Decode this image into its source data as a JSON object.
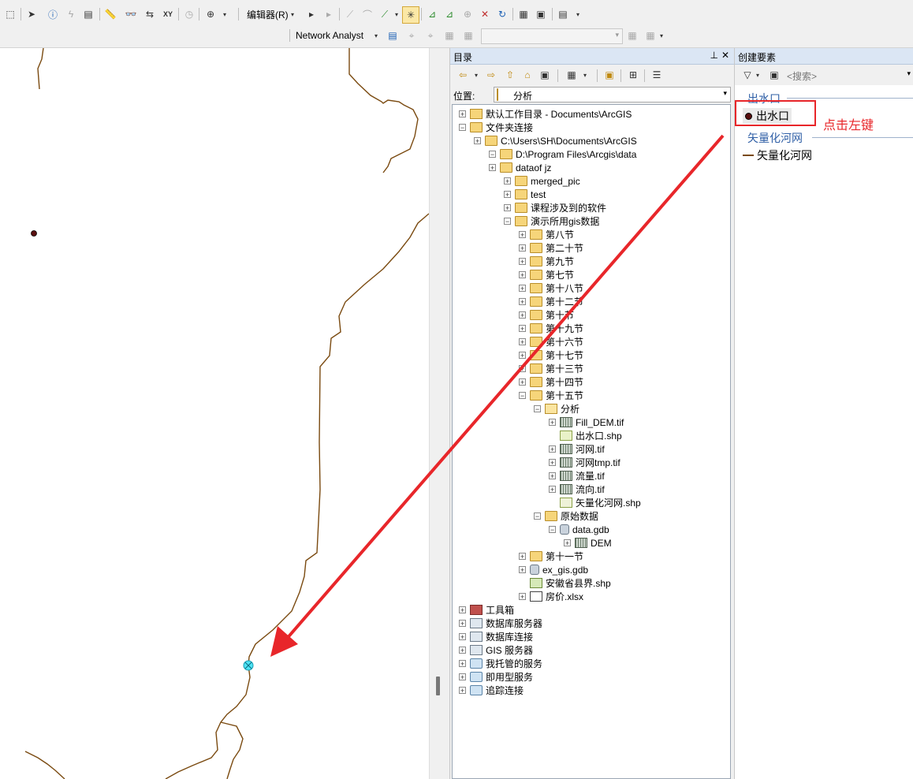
{
  "toolbar": {
    "editor_label": "编辑器(R)",
    "network_analyst_label": "Network Analyst",
    "combo_value": ""
  },
  "catalog": {
    "title": "目录",
    "location_label": "位置:",
    "location_value": "分析",
    "tree": [
      {
        "label": "默认工作目录 - Documents\\ArcGIS",
        "icon": "home-folder-icon",
        "exp": "+"
      },
      {
        "label": "文件夹连接",
        "icon": "folder-connection-icon",
        "exp": "-"
      },
      {
        "label": "C:\\Users\\SH\\Documents\\ArcGIS",
        "icon": "folder-icon",
        "exp": "+"
      },
      {
        "label": "D:\\Program Files\\Arcgis\\data",
        "icon": "folder-icon",
        "exp": "-"
      },
      {
        "label": "dataof jz",
        "icon": "folder-icon",
        "exp": "+"
      },
      {
        "label": "merged_pic",
        "icon": "folder-icon",
        "exp": "+"
      },
      {
        "label": "test",
        "icon": "folder-icon",
        "exp": "+"
      },
      {
        "label": "课程涉及到的软件",
        "icon": "folder-icon",
        "exp": "+"
      },
      {
        "label": "演示所用gis数据",
        "icon": "folder-icon",
        "exp": "-"
      },
      {
        "label": "第八节",
        "icon": "folder-icon",
        "exp": "+"
      },
      {
        "label": "第二十节",
        "icon": "folder-icon",
        "exp": "+"
      },
      {
        "label": "第九节",
        "icon": "folder-icon",
        "exp": "+"
      },
      {
        "label": "第七节",
        "icon": "folder-icon",
        "exp": "+"
      },
      {
        "label": "第十八节",
        "icon": "folder-icon",
        "exp": "+"
      },
      {
        "label": "第十二节",
        "icon": "folder-icon",
        "exp": "+"
      },
      {
        "label": "第十节",
        "icon": "folder-icon",
        "exp": "+"
      },
      {
        "label": "第十九节",
        "icon": "folder-icon",
        "exp": "+"
      },
      {
        "label": "第十六节",
        "icon": "folder-icon",
        "exp": "+"
      },
      {
        "label": "第十七节",
        "icon": "folder-icon",
        "exp": "+"
      },
      {
        "label": "第十三节",
        "icon": "folder-icon",
        "exp": "+"
      },
      {
        "label": "第十四节",
        "icon": "folder-icon",
        "exp": "+"
      },
      {
        "label": "第十五节",
        "icon": "folder-icon",
        "exp": "-"
      },
      {
        "label": "分析",
        "icon": "folder-open-icon",
        "exp": "-"
      },
      {
        "label": "Fill_DEM.tif",
        "icon": "raster-icon",
        "exp": "+"
      },
      {
        "label": "出水口.shp",
        "icon": "point-shapefile-icon",
        "exp": ""
      },
      {
        "label": "河网.tif",
        "icon": "raster-icon",
        "exp": "+"
      },
      {
        "label": "河网tmp.tif",
        "icon": "raster-icon",
        "exp": "+"
      },
      {
        "label": "流量.tif",
        "icon": "raster-icon",
        "exp": "+"
      },
      {
        "label": "流向.tif",
        "icon": "raster-icon",
        "exp": "+"
      },
      {
        "label": "矢量化河网.shp",
        "icon": "line-shapefile-icon",
        "exp": ""
      },
      {
        "label": "原始数据",
        "icon": "folder-icon",
        "exp": "-"
      },
      {
        "label": "data.gdb",
        "icon": "geodatabase-icon",
        "exp": "-"
      },
      {
        "label": "DEM",
        "icon": "raster-icon",
        "exp": "+"
      },
      {
        "label": "第十一节",
        "icon": "folder-icon",
        "exp": "+"
      },
      {
        "label": "ex_gis.gdb",
        "icon": "geodatabase-icon",
        "exp": "+"
      },
      {
        "label": "安徽省县界.shp",
        "icon": "polygon-shapefile-icon",
        "exp": ""
      },
      {
        "label": "房价.xlsx",
        "icon": "excel-icon",
        "exp": "+"
      },
      {
        "label": "工具箱",
        "icon": "toolbox-icon",
        "exp": "+"
      },
      {
        "label": "数据库服务器",
        "icon": "database-server-icon",
        "exp": "+"
      },
      {
        "label": "数据库连接",
        "icon": "database-connection-icon",
        "exp": "+"
      },
      {
        "label": "GIS 服务器",
        "icon": "gis-server-icon",
        "exp": "+"
      },
      {
        "label": "我托管的服务",
        "icon": "hosted-services-icon",
        "exp": "+"
      },
      {
        "label": "即用型服务",
        "icon": "ready-services-icon",
        "exp": "+"
      },
      {
        "label": "追踪连接",
        "icon": "tracking-connection-icon",
        "exp": "+"
      }
    ]
  },
  "create_features": {
    "title": "创建要素",
    "search_placeholder": "<搜索>",
    "group1": "出水口",
    "item1": "出水口",
    "group2": "矢量化河网",
    "item2": "矢量化河网"
  },
  "annotation": {
    "text": "点击左键",
    "color": "#e8262a"
  }
}
